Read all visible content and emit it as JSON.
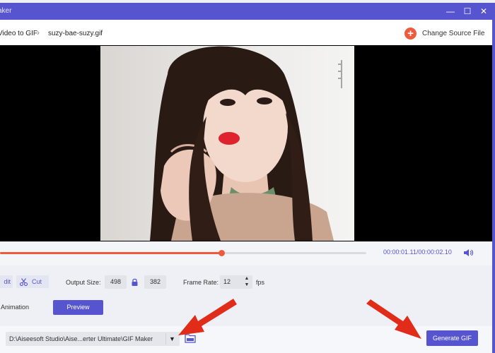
{
  "window": {
    "title": "aker",
    "controls": {
      "minimize": "—",
      "maximize": "☐",
      "close": "✕"
    }
  },
  "breadcrumb": {
    "parent": "Video to GIF",
    "current": "suzy-bae-suzy.gif"
  },
  "toolbar": {
    "change_source_label": "Change Source File"
  },
  "player": {
    "time_display": "00:00:01.11/00:00:02.10",
    "progress_fraction": 0.605
  },
  "controls": {
    "edit_label": "dit",
    "cut_label": "Cut",
    "output_size_label": "Output Size:",
    "width": "498",
    "height": "382",
    "frame_rate_label": "Frame Rate:",
    "frame_rate": "12",
    "fps_label": "fps",
    "loop_label": "p Animation",
    "preview_label": "Preview"
  },
  "save": {
    "label_stub": ":",
    "path": "D:\\Aiseesoft Studio\\Aise...erter Ultimate\\GIF Maker",
    "generate_label": "Generate GIF"
  },
  "colors": {
    "accent": "#5654cf",
    "progress": "#ee5b3c",
    "annotation_arrow": "#e12c1a"
  }
}
